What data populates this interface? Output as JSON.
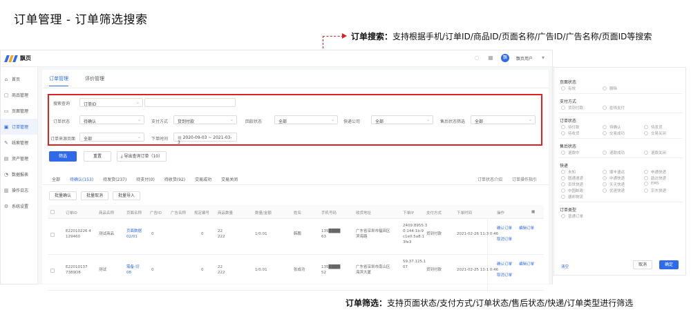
{
  "page_title": "订单管理 - 订单筛选搜索",
  "annotations": {
    "search": {
      "label": "订单搜索：",
      "text": "支持根据手机/订单ID/商品ID/页面名称/广告ID/广告名称/页面ID等搜索"
    },
    "filter": {
      "label": "订单筛选：",
      "text": "支持页面状态/支付方式/订单状态/售后状态/快递/订单类型进行筛选"
    }
  },
  "colors": {
    "accent": "#2f6ae8",
    "highlight": "#e02020"
  },
  "app": {
    "logo_name": "飘页",
    "user": {
      "avatar_text": "飘",
      "name": "飘页用户"
    },
    "topbar_icons": [
      "bell-icon",
      "grid-icon"
    ]
  },
  "sidebar": {
    "items": [
      {
        "icon": "home-icon",
        "glyph": "⌂",
        "label": "首页"
      },
      {
        "icon": "product-icon",
        "glyph": "▢",
        "label": "商品管理"
      },
      {
        "icon": "page-icon",
        "glyph": "▭",
        "label": "页面管理"
      },
      {
        "icon": "order-icon",
        "glyph": "▣",
        "label": "订单管理",
        "active": true
      },
      {
        "icon": "lead-icon",
        "glyph": "✎",
        "label": "线索管理"
      },
      {
        "icon": "asset-icon",
        "glyph": "▤",
        "label": "资产管理"
      },
      {
        "icon": "report-icon",
        "glyph": "◔",
        "label": "数据报表"
      },
      {
        "icon": "log-icon",
        "glyph": "▥",
        "label": "操作日志"
      },
      {
        "icon": "settings-icon",
        "glyph": "⚙",
        "label": "系统设置"
      }
    ]
  },
  "tabs": [
    "订单管理",
    "评价管理"
  ],
  "filters": {
    "search_field_label": "搜索查询",
    "search_field_value": "订单ID",
    "order_status_label": "订单状态",
    "order_status_value": "待确认",
    "pay_method_label": "支付方式",
    "pay_method_value": "货到付款",
    "pay_status_label": "回款状态",
    "pay_status_value": "全部",
    "express_label": "快递公司",
    "express_value": "全部",
    "aftersale_label": "售后状态筛选",
    "aftersale_value": "全部",
    "source_label": "订单来源页面",
    "source_value": "全部",
    "order_time_label": "下单时间",
    "order_time_value": "2020-09-03 ~ 2021-03-3"
  },
  "buttons": {
    "search": "筛选",
    "reset": "重置",
    "export": "导出查询订单（10）"
  },
  "status_tabs": [
    "全部",
    "待确认(153)",
    "待发货(237)",
    "待支付(0)",
    "待收货(92)",
    "交易成功",
    "交易关闭"
  ],
  "status_right": [
    "订单状态介绍",
    "订单操作指引"
  ],
  "bulk_buttons": [
    "批量确认",
    "批量取消",
    "批量导入"
  ],
  "table": {
    "headers": [
      "订单ID",
      "商品名称",
      "页面名称",
      "广告ID",
      "广告名称",
      "规定编号",
      "商品数量",
      "数量/金额",
      "姓名",
      "手机号码",
      "收货地址",
      "下单IP",
      "支付方式",
      "下单时间",
      "操作"
    ],
    "rows": [
      {
        "order_id": [
          "E22010226 4",
          "129460"
        ],
        "product": "测试商品",
        "page_name": [
          "页面数据",
          "02/01"
        ],
        "ad_id": "0",
        "spec": "0",
        "qty": [
          "22",
          "222"
        ],
        "amount": "1/0.01",
        "name": "韩鹏",
        "phone": [
          "135████",
          "63"
        ],
        "address": [
          "广东省深圳市福田区",
          "滨海路"
        ],
        "ip": [
          "2409:8955:3",
          "0:144:1b:9",
          "c1e0:5a8:1",
          "3fe3"
        ],
        "pay": "货到付款",
        "time": "2021-02-26 11:3 0:46",
        "ops": [
          "确认订单",
          "编辑订单",
          "取消订单"
        ]
      },
      {
        "order_id": [
          "E22010137",
          "7389D8"
        ],
        "product": "测试",
        "page_name": [
          "需备-切",
          "08"
        ],
        "ad_id": "0",
        "spec": "0",
        "qty": [
          "22",
          "222"
        ],
        "amount": "1/0.01",
        "name": "张成功",
        "phone": [
          "135████",
          "52"
        ],
        "address": [
          "广东省深圳市南山区",
          "海滨大厦"
        ],
        "ip": [
          "59.37.125.1",
          "07"
        ],
        "pay": "货到付款",
        "time": "2021-02-25 13:1 0:46",
        "ops": [
          "确认订单",
          "编辑订单",
          "取消订单"
        ]
      }
    ]
  },
  "panel": {
    "page_status": {
      "title": "页面状态",
      "options": [
        "有效",
        "删除"
      ]
    },
    "pay_method": {
      "title": "支付方式",
      "options": [
        "货到付款",
        "在线支付"
      ]
    },
    "order_status": {
      "title": "订单状态",
      "options": [
        "待付款",
        "待确认",
        "待发货",
        "待收货",
        "交易成功",
        "交易关闭"
      ]
    },
    "aftersale": {
      "title": "售后状态",
      "options": [
        "退款中",
        "退款成功",
        "退款关闭"
      ]
    },
    "express": {
      "title": "快递",
      "options": [
        "未知",
        "顺丰速运",
        "申通快递",
        "圆通速递",
        "中通快递",
        "韵达快递",
        "百世快递",
        "天天快递",
        "EMS",
        "中国邮政",
        "优速快递",
        "京东快递",
        "德邦物流"
      ]
    },
    "order_type": {
      "title": "订单类型",
      "options": [
        "普通订单"
      ]
    },
    "clear": "清空",
    "cancel": "取消",
    "confirm": "确定"
  }
}
